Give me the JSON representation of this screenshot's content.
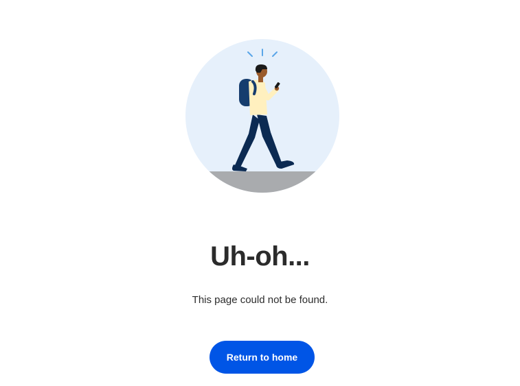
{
  "error": {
    "heading": "Uh-oh...",
    "message": "This page could not be found."
  },
  "actions": {
    "home_label": "Return to home"
  },
  "illustration": {
    "icon": "person-walking-with-phone-illustration",
    "circle_color": "#e6f0fb",
    "ground_color": "#a9abae",
    "skin_color": "#9a5b2c",
    "hair_color": "#1a1a1a",
    "shirt_color": "#fff0bf",
    "pants_color": "#0b2a52",
    "backpack_color": "#163d6e",
    "spark_color": "#5aa6e8"
  },
  "colors": {
    "accent": "#0055e6",
    "text": "#2b2b2b",
    "background": "#ffffff"
  }
}
